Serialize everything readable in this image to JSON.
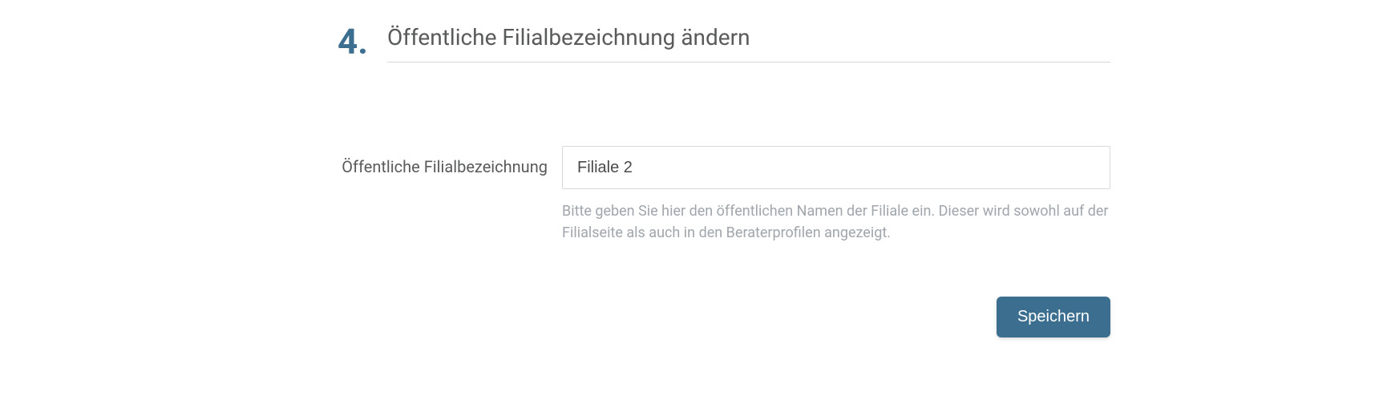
{
  "section": {
    "number": "4.",
    "title": "Öffentliche Filialbezeichnung ändern"
  },
  "form": {
    "label": "Öffentliche Filialbezeichnung",
    "input_value": "Filiale 2",
    "help_text": "Bitte geben Sie hier den öffentlichen Namen der Filiale ein. Dieser wird sowohl auf der Filialseite als auch in den Beraterprofilen angezeigt."
  },
  "actions": {
    "save_label": "Speichern"
  }
}
